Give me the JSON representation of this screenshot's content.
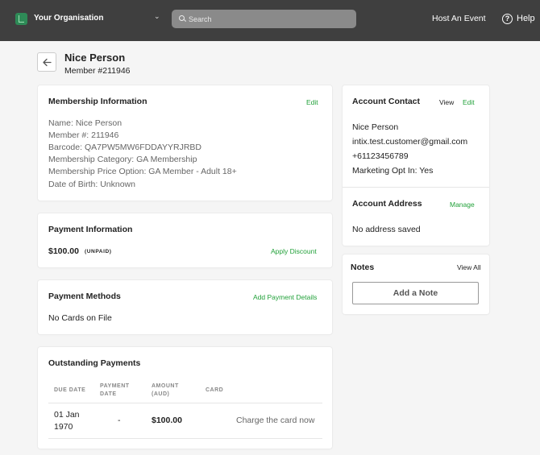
{
  "header": {
    "org_name": "Your Organisation",
    "search_placeholder": "Search",
    "host_link": "Host An Event",
    "help_label": "Help"
  },
  "member": {
    "name": "Nice Person",
    "number_label": "Member #211946"
  },
  "membership_info": {
    "title": "Membership Information",
    "edit": "Edit",
    "lines": [
      "Name: Nice Person",
      "Member #: 211946",
      "Barcode: QA7PW5MW6FDDAYYRJRBD",
      "Membership Category: GA Membership",
      "Membership Price Option: GA Member - Adult 18+",
      "Date of Birth: Unknown"
    ]
  },
  "payment_info": {
    "title": "Payment Information",
    "amount": "$100.00",
    "status": "(UNPAID)",
    "apply_discount": "Apply Discount"
  },
  "payment_methods": {
    "title": "Payment Methods",
    "add_link": "Add Payment Details",
    "empty": "No Cards on File"
  },
  "outstanding": {
    "title": "Outstanding Payments",
    "headers": {
      "due": "DUE DATE",
      "payment_line1": "PAYMENT",
      "payment_line2": "DATE",
      "amount_line1": "AMOUNT",
      "amount_line2": "(AUD)",
      "card": "CARD"
    },
    "rows": [
      {
        "due_line1": "01 Jan",
        "due_line2": "1970",
        "payment_date": "-",
        "amount": "$100.00",
        "action": "Charge the card now"
      }
    ]
  },
  "account_contact": {
    "title": "Account Contact",
    "view": "View",
    "edit": "Edit",
    "lines": [
      "Nice Person",
      "intix.test.customer@gmail.com",
      "+61123456789",
      "Marketing Opt In: Yes"
    ]
  },
  "account_address": {
    "title": "Account Address",
    "manage": "Manage",
    "value": "No address saved"
  },
  "notes": {
    "title": "Notes",
    "view_all": "View All",
    "add_button": "Add a Note"
  },
  "colors": {
    "accent_green": "#22a13a",
    "topbar": "#3f3f3f",
    "logo": "#2e8b57"
  }
}
